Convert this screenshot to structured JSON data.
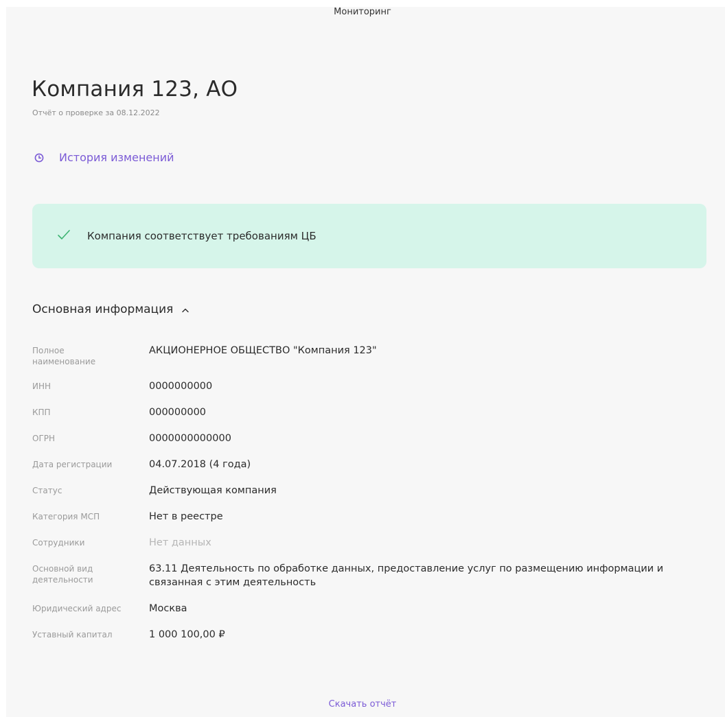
{
  "header": {
    "title": "Мониторинг"
  },
  "company": {
    "name": "Компания 123, АО",
    "report_subtitle": "Отчёт о проверке за 08.12.2022"
  },
  "history_link": {
    "label": "История изменений",
    "icon": "clock-icon"
  },
  "status_banner": {
    "icon": "check-icon",
    "text": "Компания соответствует требованиям ЦБ",
    "color": "#d6f5ea"
  },
  "basic_info": {
    "title": "Основная информация",
    "toggle_icon": "chevron-up-icon",
    "rows": [
      {
        "label": "Полное наименование",
        "value": "АКЦИОНЕРНОЕ ОБЩЕСТВО \"Компания 123\""
      },
      {
        "label": "ИНН",
        "value": "0000000000"
      },
      {
        "label": "КПП",
        "value": "000000000"
      },
      {
        "label": "ОГРН",
        "value": "0000000000000"
      },
      {
        "label": "Дата регистрации",
        "value": "04.07.2018 (4 года)"
      },
      {
        "label": "Статус",
        "value": "Действующая компания"
      },
      {
        "label": "Категория МСП",
        "value": "Нет в реестре"
      },
      {
        "label": "Сотрудники",
        "value": "Нет данных"
      },
      {
        "label": "Основной вид деятельности",
        "value": "63.11 Деятельность по обработке данных, предоставление услуг по размещению информации и связанная с этим деятельность"
      },
      {
        "label": "Юридический адрес",
        "value": "Москва"
      },
      {
        "label": "Уставный капитал",
        "value": "1 000 100,00 ₽"
      }
    ]
  },
  "download": {
    "label": "Скачать отчёт"
  },
  "colors": {
    "accent": "#7b5bd6",
    "success_bg": "#d6f5ea",
    "success_check": "#3cb371"
  }
}
